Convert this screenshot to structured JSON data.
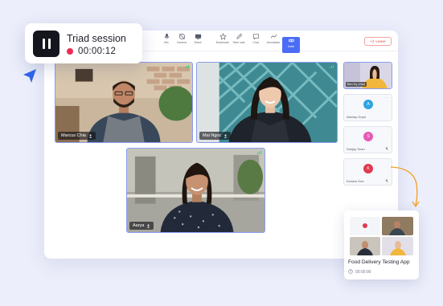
{
  "toolbar": {
    "items": [
      {
        "label": "Mic",
        "icon": "mic-icon"
      },
      {
        "label": "Camera",
        "icon": "camera-icon"
      },
      {
        "label": "Share",
        "icon": "share-screen-icon"
      },
      {
        "label": "Bookmark",
        "icon": "bookmark-icon"
      },
      {
        "label": "Take note",
        "icon": "note-icon"
      },
      {
        "label": "Chat",
        "icon": "chat-icon"
      },
      {
        "label": "Annotation",
        "icon": "annotation-icon"
      },
      {
        "label": "Invite",
        "icon": "link-icon",
        "active": true
      }
    ],
    "leave_label": "Leave"
  },
  "participants": {
    "main": [
      {
        "name": "Marcus Chia"
      },
      {
        "name": "Mai Ngoc"
      },
      {
        "name": "Aarya"
      }
    ],
    "sidebar": {
      "self": {
        "name": "Ben Ky (You)"
      },
      "others": [
        {
          "initial": "A",
          "name": "Akshay Gopir",
          "color": "#2fa3e6"
        },
        {
          "initial": "S",
          "name": "Sanjay Soan",
          "color": "#e65ab7"
        },
        {
          "initial": "K",
          "name": "Kendra Goe",
          "color": "#e03a4f"
        }
      ]
    }
  },
  "session": {
    "title": "Triad session",
    "timer": "00:00:12"
  },
  "recording": {
    "title": "Food Delivery Testing App",
    "duration": "00:00:00"
  },
  "colors": {
    "accent": "#4a6cf7",
    "record": "#f02a54",
    "leave": "#e04848",
    "background": "#eceefb"
  }
}
